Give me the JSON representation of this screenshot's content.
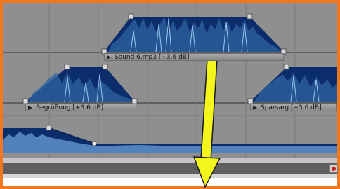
{
  "timeline": {
    "clips": [
      {
        "name": "sound-6",
        "label": "Sound 6.mp3 [+3.6 dB]"
      },
      {
        "name": "begruessung",
        "label": "Begrüßung [+3.6 dB]"
      },
      {
        "name": "sparsarg",
        "label": "Sparsarg [+3.6 dB]"
      }
    ]
  },
  "colors": {
    "frame_border": "#f07820",
    "track_background": "#8f8f8f",
    "waveform_fill": "#0c2d6b",
    "waveform_peak": "#7fb6e6",
    "annotation_arrow": "#f5f51e"
  },
  "icons": [
    "envelope-handle-icon",
    "play-triangle-icon",
    "record-icon",
    "arrow-down-icon"
  ]
}
